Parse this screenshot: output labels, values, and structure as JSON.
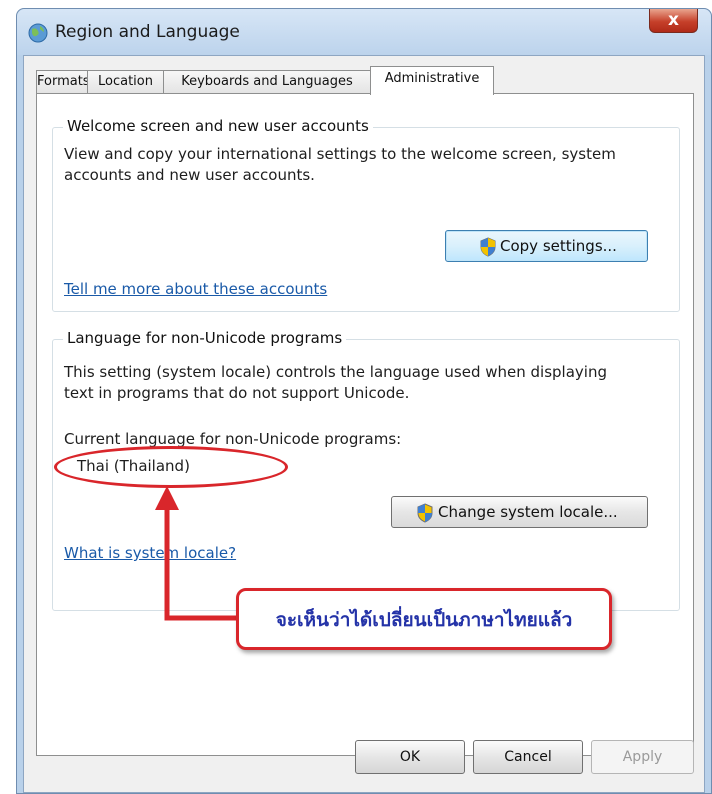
{
  "window": {
    "title": "Region and Language",
    "close_label": "x"
  },
  "tabs": [
    {
      "label": "Formats"
    },
    {
      "label": "Location"
    },
    {
      "label": "Keyboards and Languages"
    },
    {
      "label": "Administrative"
    }
  ],
  "welcome_group": {
    "legend": "Welcome screen and new user accounts",
    "line1": "View and copy your international settings to the welcome screen, system",
    "line2": "accounts and new user accounts.",
    "button": "Copy settings...",
    "link": "Tell me more about these accounts"
  },
  "locale_group": {
    "legend": "Language for non-Unicode programs",
    "line1": "This setting (system locale) controls the language used when displaying",
    "line2": "text in programs that do not support Unicode.",
    "current_label": "Current language for non-Unicode programs:",
    "current_value": "Thai (Thailand)",
    "button": "Change system locale...",
    "link": "What is system locale?"
  },
  "annotation": {
    "callout": "จะเห็นว่าได้เปลี่ยนเป็นภาษาไทยแล้ว"
  },
  "footer": {
    "ok": "OK",
    "cancel": "Cancel",
    "apply": "Apply"
  },
  "colors": {
    "accent_red": "#d9262b",
    "link": "#1a5aa8",
    "callout_text": "#2433a8"
  }
}
